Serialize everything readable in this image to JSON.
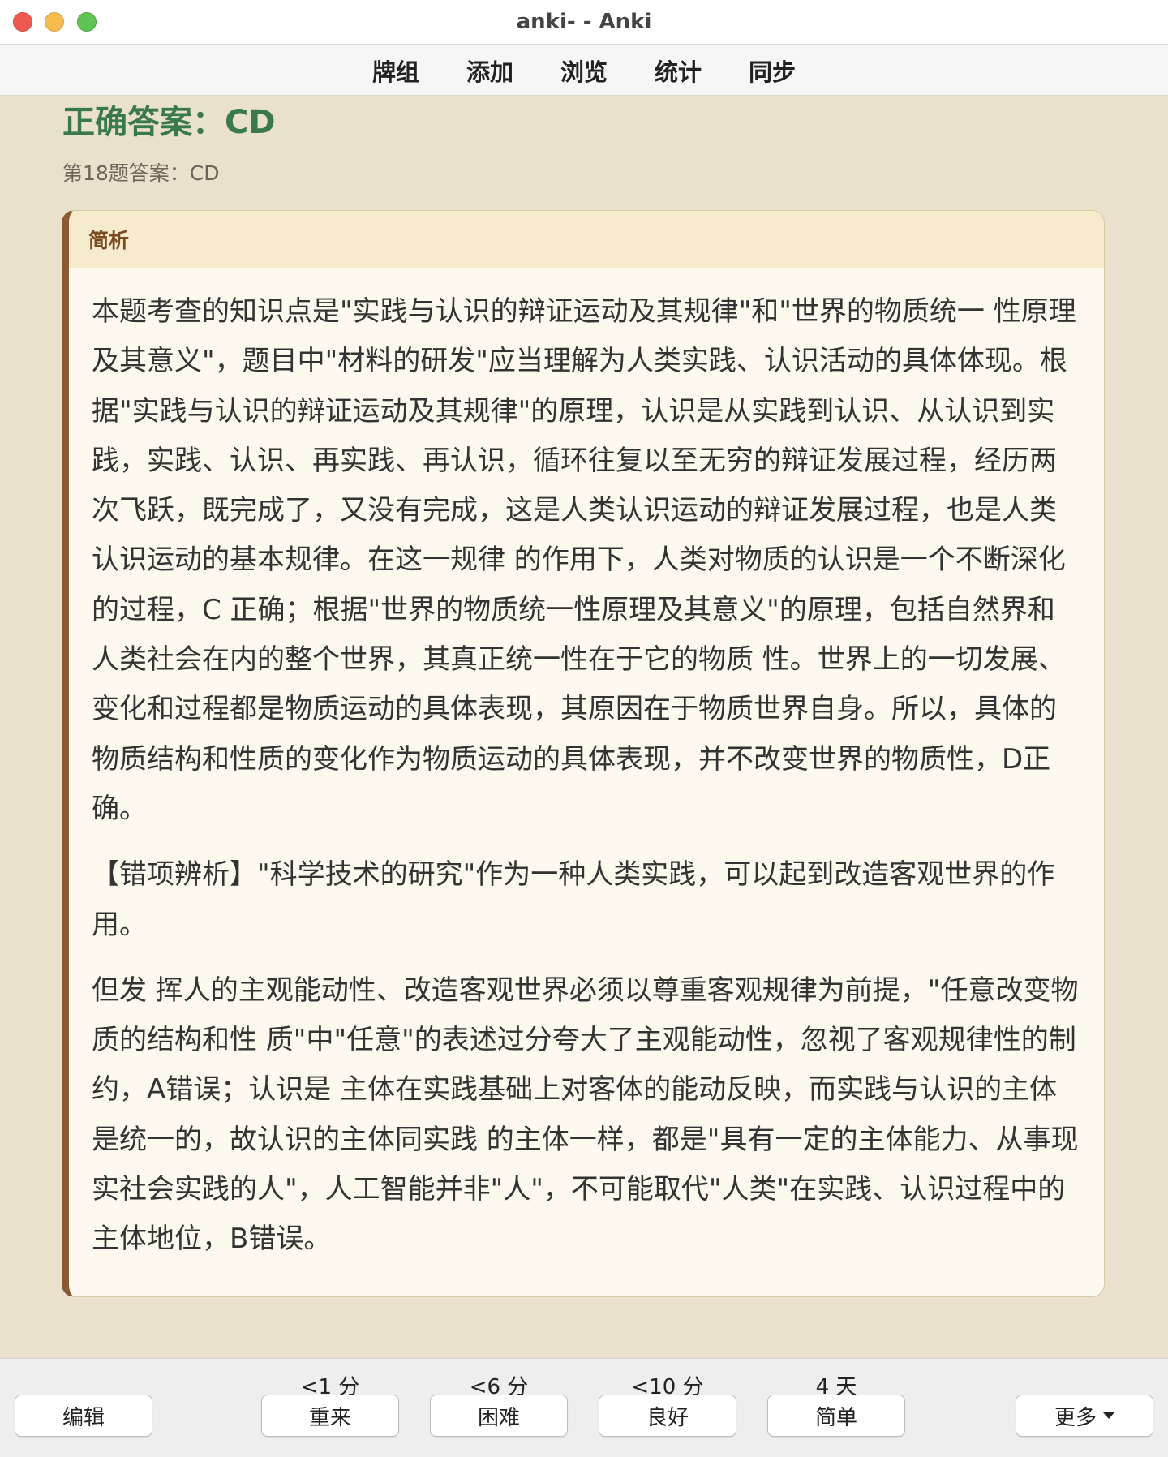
{
  "window": {
    "title": "anki- - Anki"
  },
  "toolbar": {
    "tabs": [
      "牌组",
      "添加",
      "浏览",
      "统计",
      "同步"
    ]
  },
  "answer": {
    "title": "正确答案：CD",
    "subtitle": "第18题答案：CD"
  },
  "card": {
    "header": "简析",
    "paragraphs": [
      "本题考查的知识点是\"实践与认识的辩证运动及其规律\"和\"世界的物质统一 性原理及其意义\"，题目中\"材料的研发\"应当理解为人类实践、认识活动的具体体现。根 据\"实践与认识的辩证运动及其规律\"的原理，认识是从实践到认识、从认识到实践，实践、认识、再实践、再认识，循环往复以至无穷的辩证发展过程，经历两次飞跃，既完成了，又没有完成，这是人类认识运动的辩证发展过程，也是人类认识运动的基本规律。在这一规律 的作用下，人类对物质的认识是一个不断深化的过程，C 正确；根据\"世界的物质统一性原理及其意义\"的原理，包括自然界和人类社会在内的整个世界，其真正统一性在于它的物质 性。世界上的一切发展、变化和过程都是物质运动的具体表现，其原因在于物质世界自身。所以，具体的物质结构和性质的变化作为物质运动的具体表现，并不改变世界的物质性，D正确。",
      "【错项辨析】\"科学技术的研究\"作为一种人类实践，可以起到改造客观世界的作用。",
      "但发 挥人的主观能动性、改造客观世界必须以尊重客观规律为前提，\"任意改变物质的结构和性 质\"中\"任意\"的表述过分夸大了主观能动性，忽视了客观规律性的制约，A错误；认识是 主体在实践基础上对客体的能动反映，而实践与认识的主体是统一的，故认识的主体同实践 的主体一样，都是\"具有一定的主体能力、从事现实社会实践的人\"，人工智能并非\"人\"，不可能取代\"人类\"在实践、认识过程中的主体地位，B错误。"
    ]
  },
  "bottom": {
    "edit": "编辑",
    "answers": [
      {
        "interval": "<1 分",
        "label": "重来"
      },
      {
        "interval": "<6 分",
        "label": "困难"
      },
      {
        "interval": "<10 分",
        "label": "良好"
      },
      {
        "interval": "4 天",
        "label": "简单"
      }
    ],
    "more": "更多"
  }
}
